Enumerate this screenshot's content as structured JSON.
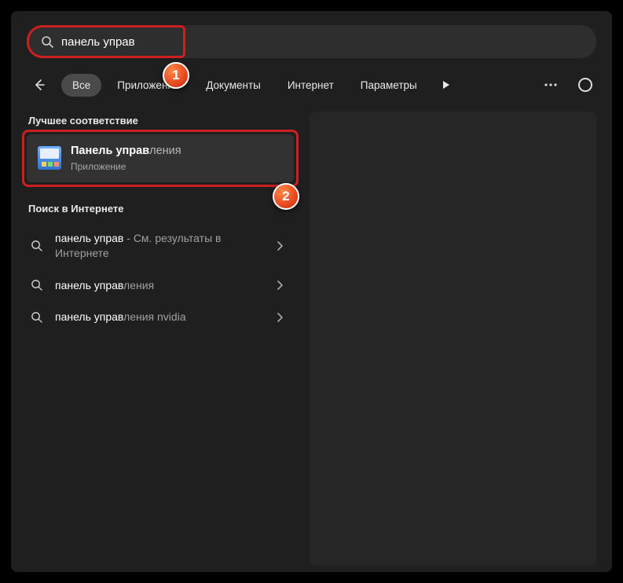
{
  "search": {
    "value": "панель управ"
  },
  "filters": {
    "back_aria": "Назад",
    "items": [
      {
        "label": "Все",
        "active": true
      },
      {
        "label": "Приложения",
        "active": false
      },
      {
        "label": "Документы",
        "active": false
      },
      {
        "label": "Интернет",
        "active": false
      },
      {
        "label": "Параметры",
        "active": false
      }
    ]
  },
  "sections": {
    "best_match_header": "Лучшее соответствие",
    "web_header": "Поиск в Интернете"
  },
  "best_match": {
    "title_bold": "Панель управ",
    "title_rest": "ления",
    "subtitle": "Приложение"
  },
  "web_results": [
    {
      "bold": "панель управ",
      "rest": " - См. результаты в Интернете"
    },
    {
      "bold": "панель управ",
      "rest": "ления"
    },
    {
      "bold": "панель управ",
      "rest": "ления nvidia"
    }
  ],
  "annotations": {
    "badge1": "1",
    "badge2": "2"
  }
}
